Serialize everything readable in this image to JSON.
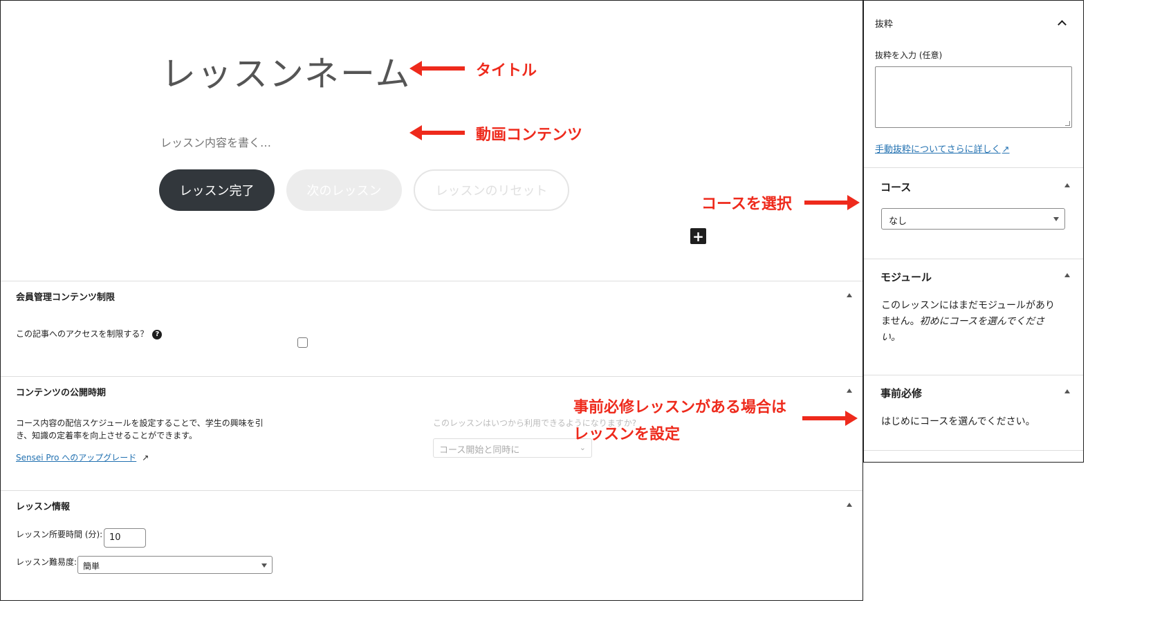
{
  "editor": {
    "title": "レッスンネーム",
    "content_placeholder": "レッスン内容を書く…",
    "buttons": {
      "complete": "レッスン完了",
      "next": "次のレッスン",
      "reset": "レッスンのリセット"
    },
    "add_block_symbol": "+"
  },
  "panels": {
    "membership": {
      "title": "会員管理コンテンツ制限",
      "question": "この記事へのアクセスを制限する？",
      "help_symbol": "?",
      "checked": false
    },
    "schedule": {
      "title": "コンテンツの公開時期",
      "description": "コース内容の配信スケジュールを設定することで、学生の興味を引き、知識の定着率を向上させることができます。",
      "upgrade_link": "Sensei Pro へのアップグレード",
      "availability_question": "このレッスンはいつから利用できるようになりますか?",
      "availability_value": "コース開始と同時に"
    },
    "lesson_info": {
      "title": "レッスン情報",
      "duration_label": "レッスン所要時間 (分):",
      "duration_value": "10",
      "difficulty_label": "レッスン難易度:",
      "difficulty_value": "簡単"
    }
  },
  "sidebar": {
    "excerpt": {
      "title": "抜粋",
      "input_label": "抜粋を入力 (任意)",
      "learn_more_link": "手動抜粋についてさらに詳しく"
    },
    "course": {
      "title": "コース",
      "selected": "なし"
    },
    "module": {
      "title": "モジュール",
      "message_normal": "このレッスンにはまだモジュールがありません。",
      "message_italic": "初めにコースを選んでください。"
    },
    "prerequisite": {
      "title": "事前必修",
      "message": "はじめにコースを選んでください。"
    }
  },
  "annotations": {
    "title": "タイトル",
    "video": "動画コンテンツ",
    "course_select": "コースを選択",
    "prereq_line1": "事前必修レッスンがある場合は",
    "prereq_line2": "レッスンを設定"
  },
  "colors": {
    "annotation": "#ee2a1c",
    "link": "#2271b1",
    "dark_button": "#32373c"
  }
}
